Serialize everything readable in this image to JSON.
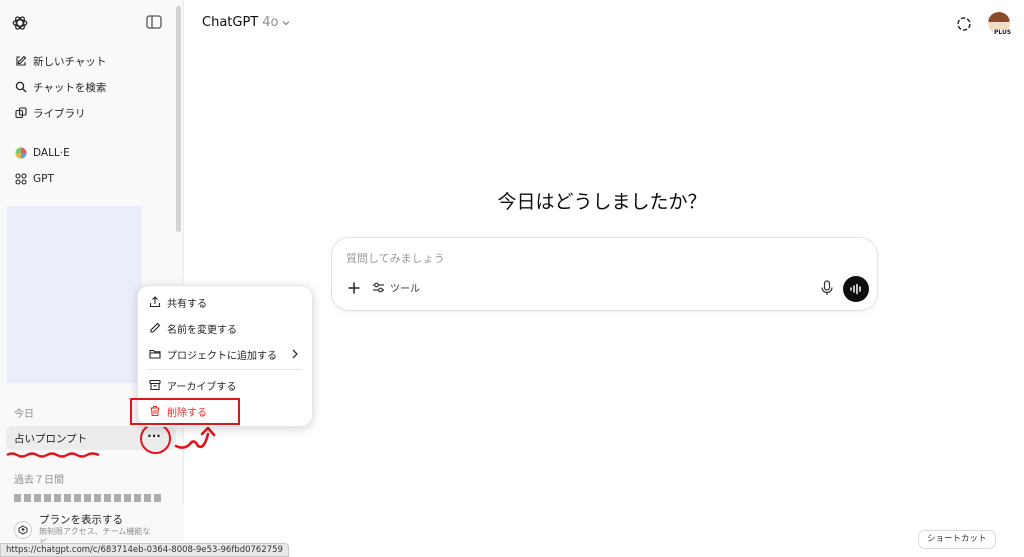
{
  "sidebar": {
    "nav": {
      "new_chat": "新しいチャット",
      "search": "チャットを検索",
      "library": "ライブラリ"
    },
    "gpts": {
      "dalle": "DALL·E",
      "gpt": "GPT"
    },
    "section_today": "今日",
    "chat_item": "占いプロンプト",
    "section_past7": "過去７日間",
    "plan": {
      "title": "プランを表示する",
      "subtitle": "無制限アクセス、チーム機能な",
      "subtitle2": "ど"
    }
  },
  "context_menu": {
    "share": "共有する",
    "rename": "名前を変更する",
    "add_to_project": "プロジェクトに追加する",
    "archive": "アーカイブする",
    "delete": "削除する"
  },
  "header": {
    "model_name": "ChatGPT",
    "model_version": "4o"
  },
  "main": {
    "headline": "今日はどうしましたか？",
    "composer": {
      "placeholder": "質問してみましょう",
      "tools_label": "ツール"
    },
    "shortcut_label": "ショートカット"
  },
  "status_url": "https://chatgpt.com/c/683714eb-0364-8008-9e53-96fbd0762759",
  "colors": {
    "annotation_red": "#e0141b",
    "danger_text": "#e02e2a",
    "sidebar_bg": "#f9f9f9"
  }
}
